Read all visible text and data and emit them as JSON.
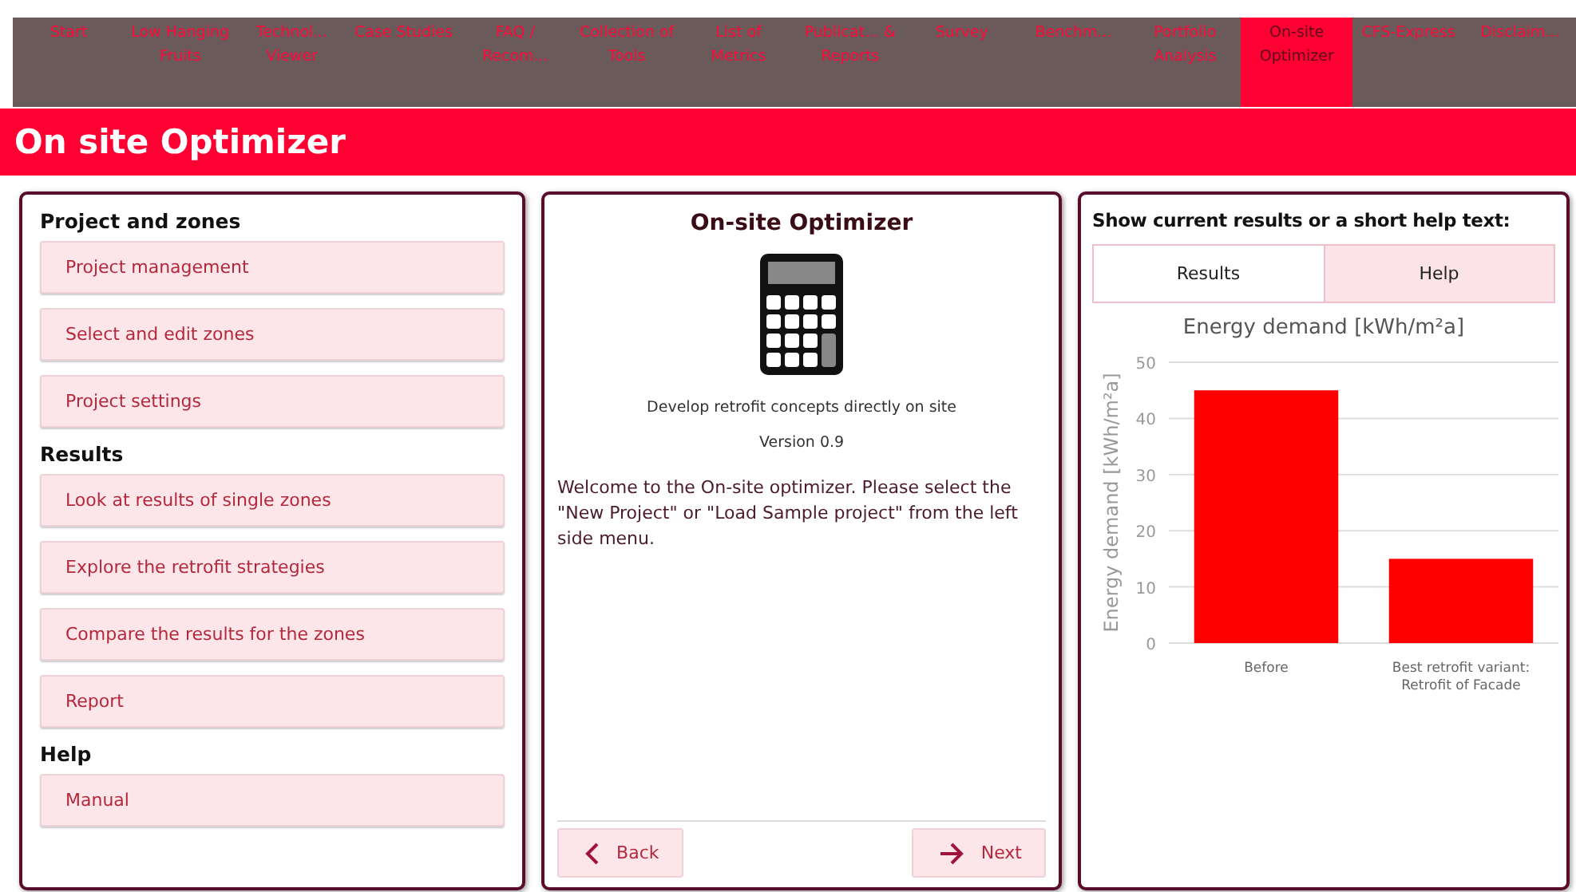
{
  "nav": [
    {
      "label": "Start",
      "selected": false
    },
    {
      "label": "Low Hanging Fruits",
      "selected": false
    },
    {
      "label": "Technol... Viewer",
      "selected": false
    },
    {
      "label": "Case Studies",
      "selected": false
    },
    {
      "label": "FAQ / Recom...",
      "selected": false
    },
    {
      "label": "Collection of Tools",
      "selected": false
    },
    {
      "label": "List of Metrics",
      "selected": false
    },
    {
      "label": "Publicat... & Reports",
      "selected": false
    },
    {
      "label": "Survey",
      "selected": false
    },
    {
      "label": "Benchm...",
      "selected": false
    },
    {
      "label": "Portfolio Analysis",
      "selected": false
    },
    {
      "label": "On-site Optimizer",
      "selected": true
    },
    {
      "label": "CFS-Express",
      "selected": false
    },
    {
      "label": "Disclaim...",
      "selected": false
    }
  ],
  "page_title": "On site Optimizer",
  "sidebar": {
    "sections": [
      {
        "heading": "Project and zones",
        "items": [
          "Project management",
          "Select and edit zones",
          "Project settings"
        ]
      },
      {
        "heading": "Results",
        "items": [
          "Look at results of single zones",
          "Explore the retrofit strategies",
          "Compare the results for the zones",
          "Report"
        ]
      },
      {
        "heading": "Help",
        "items": [
          "Manual"
        ]
      }
    ]
  },
  "main": {
    "title": "On-site Optimizer",
    "subtitle": "Develop retrofit concepts directly on site",
    "version": "Version 0.9",
    "message": "Welcome to the On-site optimizer. Please select the \"New Project\" or \"Load Sample project\" from the left side menu.",
    "back": "Back",
    "next": "Next"
  },
  "results": {
    "heading": "Show current results or a short help text:",
    "tabs": [
      {
        "label": "Results",
        "selected": true
      },
      {
        "label": "Help",
        "selected": false
      }
    ],
    "chart_data": {
      "type": "bar",
      "title": "Energy demand [kWh/m²a]",
      "ylabel": "Energy demand [kWh/m²a]",
      "categories": [
        "Before",
        "Best retrofit variant: Retrofit of Facade"
      ],
      "values": [
        45,
        15
      ],
      "color": "#ff0000",
      "grid": true,
      "ylim": [
        0,
        50
      ],
      "yticks": [
        0,
        10,
        20,
        30,
        40,
        50
      ]
    }
  }
}
